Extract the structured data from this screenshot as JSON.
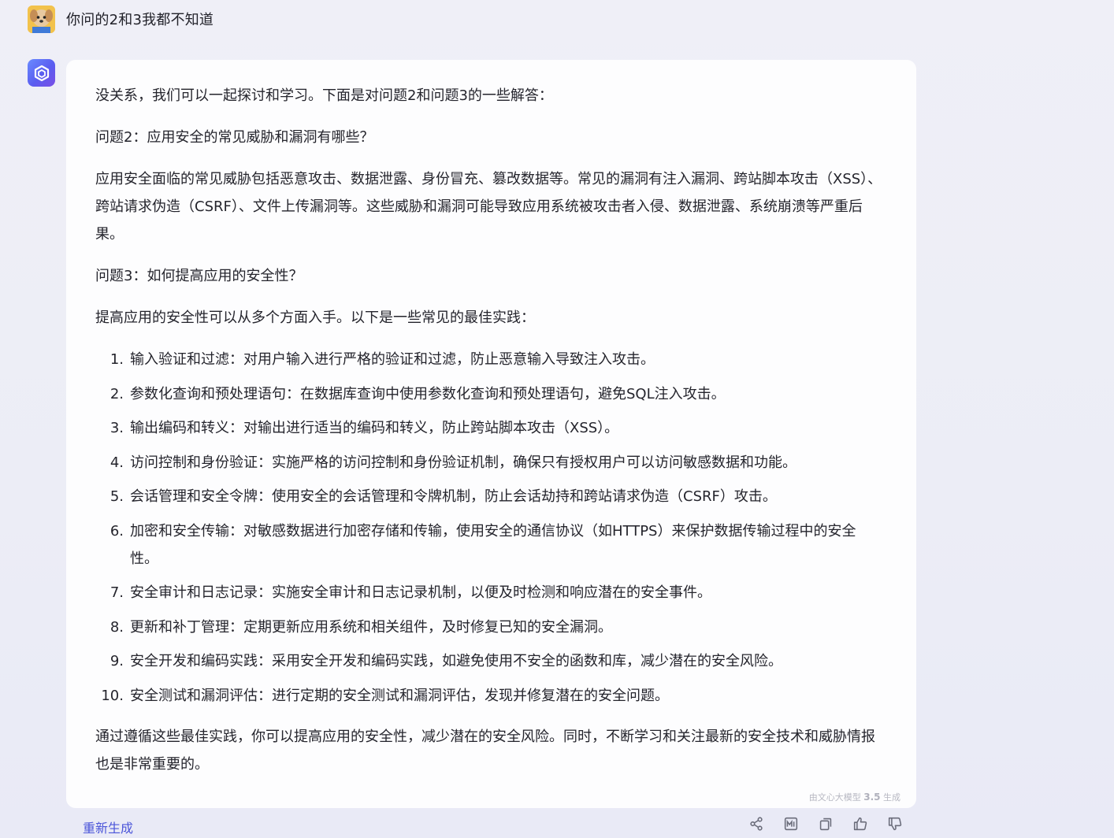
{
  "user": {
    "message": "你问的2和3我都不知道",
    "avatar_icon": "puppy-avatar"
  },
  "assistant": {
    "avatar_icon": "ernie-logo",
    "intro": "没关系，我们可以一起探讨和学习。下面是对问题2和问题3的一些解答：",
    "q2_title": "问题2：应用安全的常见威胁和漏洞有哪些？",
    "q2_answer": "应用安全面临的常见威胁包括恶意攻击、数据泄露、身份冒充、篡改数据等。常见的漏洞有注入漏洞、跨站脚本攻击（XSS）、跨站请求伪造（CSRF）、文件上传漏洞等。这些威胁和漏洞可能导致应用系统被攻击者入侵、数据泄露、系统崩溃等严重后果。",
    "q3_title": "问题3：如何提高应用的安全性？",
    "q3_intro": "提高应用的安全性可以从多个方面入手。以下是一些常见的最佳实践：",
    "practices": [
      {
        "num": "1.",
        "text": "输入验证和过滤：对用户输入进行严格的验证和过滤，防止恶意输入导致注入攻击。"
      },
      {
        "num": "2.",
        "text": "参数化查询和预处理语句：在数据库查询中使用参数化查询和预处理语句，避免SQL注入攻击。"
      },
      {
        "num": "3.",
        "text": "输出编码和转义：对输出进行适当的编码和转义，防止跨站脚本攻击（XSS）。"
      },
      {
        "num": "4.",
        "text": "访问控制和身份验证：实施严格的访问控制和身份验证机制，确保只有授权用户可以访问敏感数据和功能。"
      },
      {
        "num": "5.",
        "text": "会话管理和安全令牌：使用安全的会话管理和令牌机制，防止会话劫持和跨站请求伪造（CSRF）攻击。"
      },
      {
        "num": "6.",
        "text": "加密和安全传输：对敏感数据进行加密存储和传输，使用安全的通信协议（如HTTPS）来保护数据传输过程中的安全性。"
      },
      {
        "num": "7.",
        "text": "安全审计和日志记录：实施安全审计和日志记录机制，以便及时检测和响应潜在的安全事件。"
      },
      {
        "num": "8.",
        "text": "更新和补丁管理：定期更新应用系统和相关组件，及时修复已知的安全漏洞。"
      },
      {
        "num": "9.",
        "text": "安全开发和编码实践：采用安全开发和编码实践，如避免使用不安全的函数和库，减少潜在的安全风险。"
      },
      {
        "num": "10.",
        "text": "安全测试和漏洞评估：进行定期的安全测试和漏洞评估，发现并修复潜在的安全问题。"
      }
    ],
    "conclusion": "通过遵循这些最佳实践，你可以提高应用的安全性，减少潜在的安全风险。同时，不断学习和关注最新的安全技术和威胁情报也是非常重要的。",
    "badge_prefix": "由文心大模型",
    "badge_version": "3.5",
    "badge_suffix": "生成"
  },
  "actions": {
    "regenerate_label": "重新生成",
    "icons": [
      "share-icon",
      "image-export-icon",
      "copy-icon",
      "thumbs-up-icon",
      "thumbs-down-icon"
    ]
  },
  "colors": {
    "accent": "#4b55d9",
    "bot_avatar": "#5a5df0",
    "card_bg": "#fdfdfe"
  }
}
